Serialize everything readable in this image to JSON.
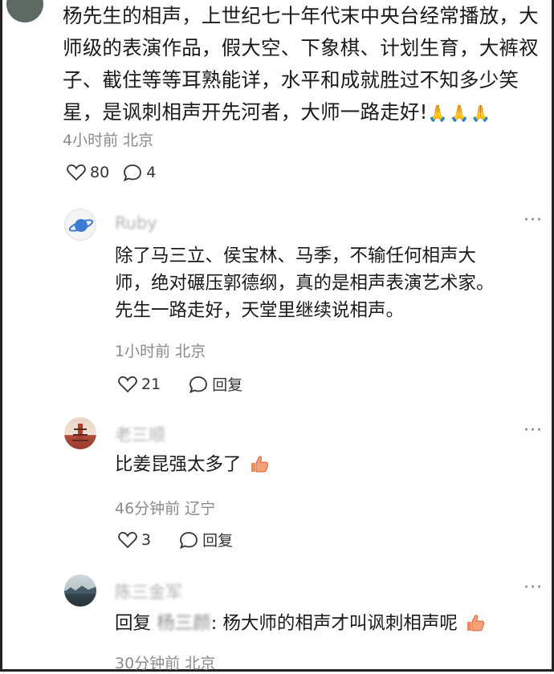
{
  "comment": {
    "text": "杨先生的相声，上世纪七十年代末中央台经常播放，大师级的表演作品，假大空、下象棋、计划生育，大裤衩子、截住等等耳熟能详，水平和成就胜过不知多少笑星，是讽刺相声开先河者，大师一路走好!",
    "meta": "4小时前 北京",
    "likes": "80",
    "replies": "4"
  },
  "replies": [
    {
      "username": "Ruby",
      "text_line1": "除了马三立、侯宝林、马季，不输任何相声大",
      "text_line2": "师，绝对碾压郭德纲，真的是相声表演艺术家。",
      "text_line3": "先生一路走好，天堂里继续说相声。",
      "meta": "1小时前 北京",
      "likes": "21",
      "reply_label": "回复"
    },
    {
      "username": "老三顺",
      "text": "比姜昆强太多了",
      "meta": "46分钟前 辽宁",
      "likes": "3",
      "reply_label": "回复"
    },
    {
      "username": "陈三金军",
      "reply_prefix": "回复",
      "reply_to": "杨三颜",
      "text": ": 杨大师的相声才叫讽刺相声呢",
      "meta": "30分钟前 北京"
    }
  ],
  "icons": {
    "more": "more-icon",
    "like": "heart-icon",
    "comment": "comment-icon"
  },
  "colors": {
    "text": "#1a1a1a",
    "meta": "#8a8a8a",
    "emoji": "#e0603c"
  }
}
